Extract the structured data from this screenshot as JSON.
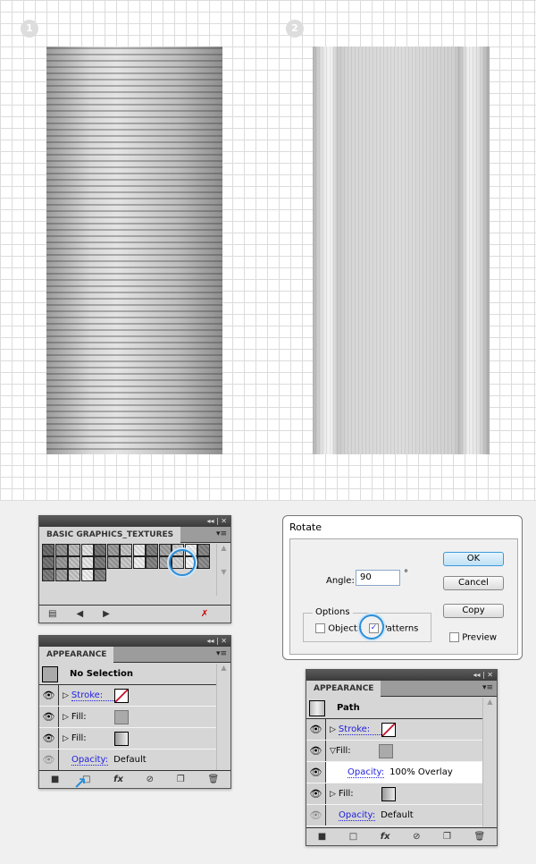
{
  "steps": [
    "1",
    "2"
  ],
  "textures_panel": {
    "title": "BASIC GRAPHICS_TEXTURES",
    "controls": "◂◂ | ✕",
    "menu": "▾≡"
  },
  "appearance1": {
    "title": "APPEARANCE",
    "controls": "◂◂ | ✕",
    "menu": "▾≡",
    "header": "No Selection",
    "rows": [
      {
        "label": "Stroke:",
        "link": true
      },
      {
        "label": "Fill:"
      },
      {
        "label": "Fill:"
      }
    ],
    "opacity_label": "Opacity:",
    "opacity_value": "Default"
  },
  "rotate": {
    "title": "Rotate",
    "angle_label": "Angle:",
    "angle_value": "90",
    "degree": "°",
    "ok": "OK",
    "cancel": "Cancel",
    "copy": "Copy",
    "preview": "Preview",
    "preview_checked": false,
    "options_label": "Options",
    "objects": "Objects",
    "objects_checked": false,
    "patterns": "Patterns",
    "patterns_checked": true,
    "check": "✓"
  },
  "appearance2": {
    "title": "APPEARANCE",
    "controls": "◂◂ | ✕",
    "menu": "▾≡",
    "header": "Path",
    "stroke": "Stroke:",
    "fill1": "Fill:",
    "sub_opacity_label": "Opacity:",
    "sub_opacity_value": "100% Overlay",
    "fill2": "Fill:",
    "opacity_label": "Opacity:",
    "opacity_value": "Default"
  },
  "colors": {
    "accent": "#2b8fd8",
    "link": "#2020e0",
    "stroke_none": "#c8102e"
  }
}
